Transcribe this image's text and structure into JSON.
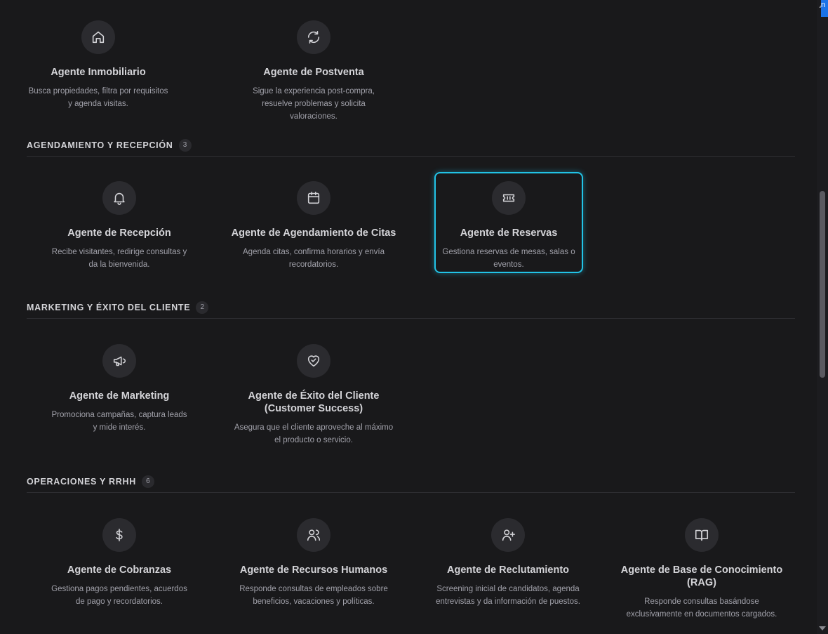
{
  "sections": [
    {
      "title": "",
      "count": "",
      "cards": [
        {
          "title": "Agente Inmobiliario",
          "desc": "Busca propiedades, filtra por requisitos y agenda visitas.",
          "icon": "home-icon"
        },
        {
          "title": "Agente de Postventa",
          "desc": "Sigue la experiencia post-compra, resuelve problemas y solicita valoraciones.",
          "icon": "refresh-icon"
        }
      ]
    },
    {
      "title": "AGENDAMIENTO Y RECEPCIÓN",
      "count": "3",
      "cards": [
        {
          "title": "Agente de Recepción",
          "desc": "Recibe visitantes, redirige consultas y da la bienvenida.",
          "icon": "bell-icon"
        },
        {
          "title": "Agente de Agendamiento de Citas",
          "desc": "Agenda citas, confirma horarios y envía recordatorios.",
          "icon": "calendar-icon"
        },
        {
          "title": "Agente de Reservas",
          "desc": "Gestiona reservas de mesas, salas o eventos.",
          "icon": "ticket-icon",
          "selected": true
        }
      ]
    },
    {
      "title": "MARKETING Y ÉXITO DEL CLIENTE",
      "count": "2",
      "cards": [
        {
          "title": "Agente de Marketing",
          "desc": "Promociona campañas, captura leads y mide interés.",
          "icon": "megaphone-icon"
        },
        {
          "title": "Agente de Éxito del Cliente (Customer Success)",
          "desc": "Asegura que el cliente aproveche al máximo el producto o servicio.",
          "icon": "heart-handshake-icon"
        }
      ]
    },
    {
      "title": "OPERACIONES Y RRHH",
      "count": "6",
      "cards": [
        {
          "title": "Agente de Cobranzas",
          "desc": "Gestiona pagos pendientes, acuerdos de pago y recordatorios.",
          "icon": "dollar-icon"
        },
        {
          "title": "Agente de Recursos Humanos",
          "desc": "Responde consultas de empleados sobre beneficios, vacaciones y políticas.",
          "icon": "users-icon"
        },
        {
          "title": "Agente de Reclutamiento",
          "desc": "Screening inicial de candidatos, agenda entrevistas y da información de puestos.",
          "icon": "user-plus-icon"
        },
        {
          "title": "Agente de Base de Conocimiento (RAG)",
          "desc": "Responde consultas basándose exclusivamente en documentos cargados.",
          "icon": "book-open-icon"
        }
      ]
    }
  ],
  "corner_tab_text": "n"
}
